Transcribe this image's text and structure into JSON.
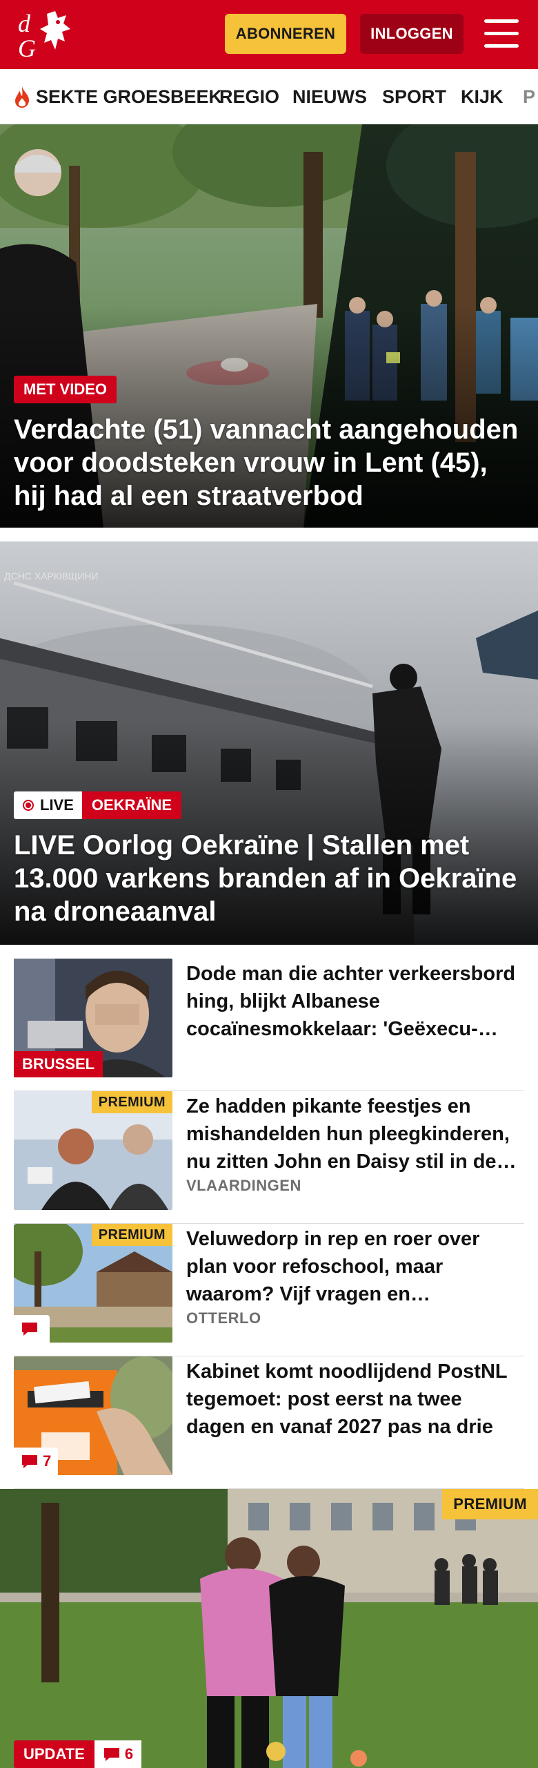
{
  "header": {
    "subscribe_label": "ABONNEREN",
    "login_label": "INLOGGEN",
    "brand_color": "#d0021b"
  },
  "nav": {
    "items": [
      {
        "label": "SEKTE GROESBEEK",
        "icon": "flame-icon"
      },
      {
        "label": "REGIO"
      },
      {
        "label": "NIEUWS"
      },
      {
        "label": "SPORT"
      },
      {
        "label": "KIJK"
      },
      {
        "label": "P"
      }
    ]
  },
  "hero1": {
    "badge": "MET VIDEO",
    "title": "Verdachte (51) vannacht aangehouden voor doodsteken vrouw in Lent (45), hij had al een straatverbod"
  },
  "hero2": {
    "live_label": "LIVE",
    "category": "OEKRAÏNE",
    "title": "LIVE Oorlog Oekraïne | Stallen met 13.000 varkens branden af in Oekraïne na droneaanval",
    "watermark": "ДСНС ХАРКІВЩИНИ"
  },
  "articles": [
    {
      "title": "Dode man die achter verkeers­bord hing, blijkt Albanese cocaïnesmokkelaar: 'Geëxecu­teerd'",
      "region_badge": "BRUSSEL",
      "location": "",
      "premium": false
    },
    {
      "title": "Ze hadden pikante feestjes en mishandelden hun pleegkinde­ren, nu zitten John en Daisy stil in de rechtbank",
      "premium_label": "PREMIUM",
      "location": "VLAARDINGEN"
    },
    {
      "title": "Veluwedorp in rep en roer over plan voor refoschool, maar waarom? Vijf vragen en antwoorden",
      "premium_label": "PREMIUM",
      "location": "OTTERLO",
      "comment_count": ""
    },
    {
      "title": "Kabinet komt noodlijdend PostNL tegemoet: post eerst na twee dagen en vanaf 2027 pas na drie",
      "comment_count": "7"
    }
  ],
  "hero3": {
    "premium_label": "PREMIUM",
    "update_label": "UPDATE",
    "comment_count": "6"
  }
}
